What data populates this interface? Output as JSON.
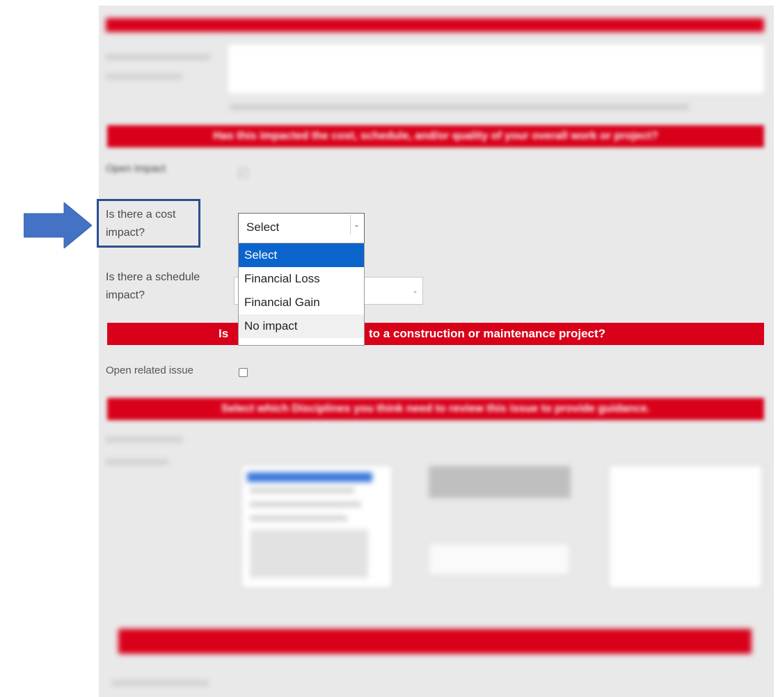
{
  "form": {
    "impact_header": "Has this impacted the cost, schedule, and/or quality of your overall work or project?",
    "open_impact_label": "Open Impact",
    "cost_impact": {
      "label": "Is there a cost impact?",
      "selected": "Select",
      "options": [
        "Select",
        "Financial Loss",
        "Financial Gain",
        "No impact"
      ]
    },
    "schedule_impact_label": "Is there a schedule impact?",
    "related_header_prefix": "Is",
    "related_header_suffix": "to a construction or maintenance project?",
    "open_related_label": "Open related issue",
    "disciplines_header": "Select which Disciplines you think need to review this issue to provide guidance."
  },
  "colors": {
    "header_red": "#d9001a",
    "dropdown_selected": "#0a64cc",
    "arrow_blue": "#4472c4",
    "highlight_border": "#2e4d8c"
  },
  "annotation": {
    "arrow_icon": "right-arrow-icon"
  }
}
